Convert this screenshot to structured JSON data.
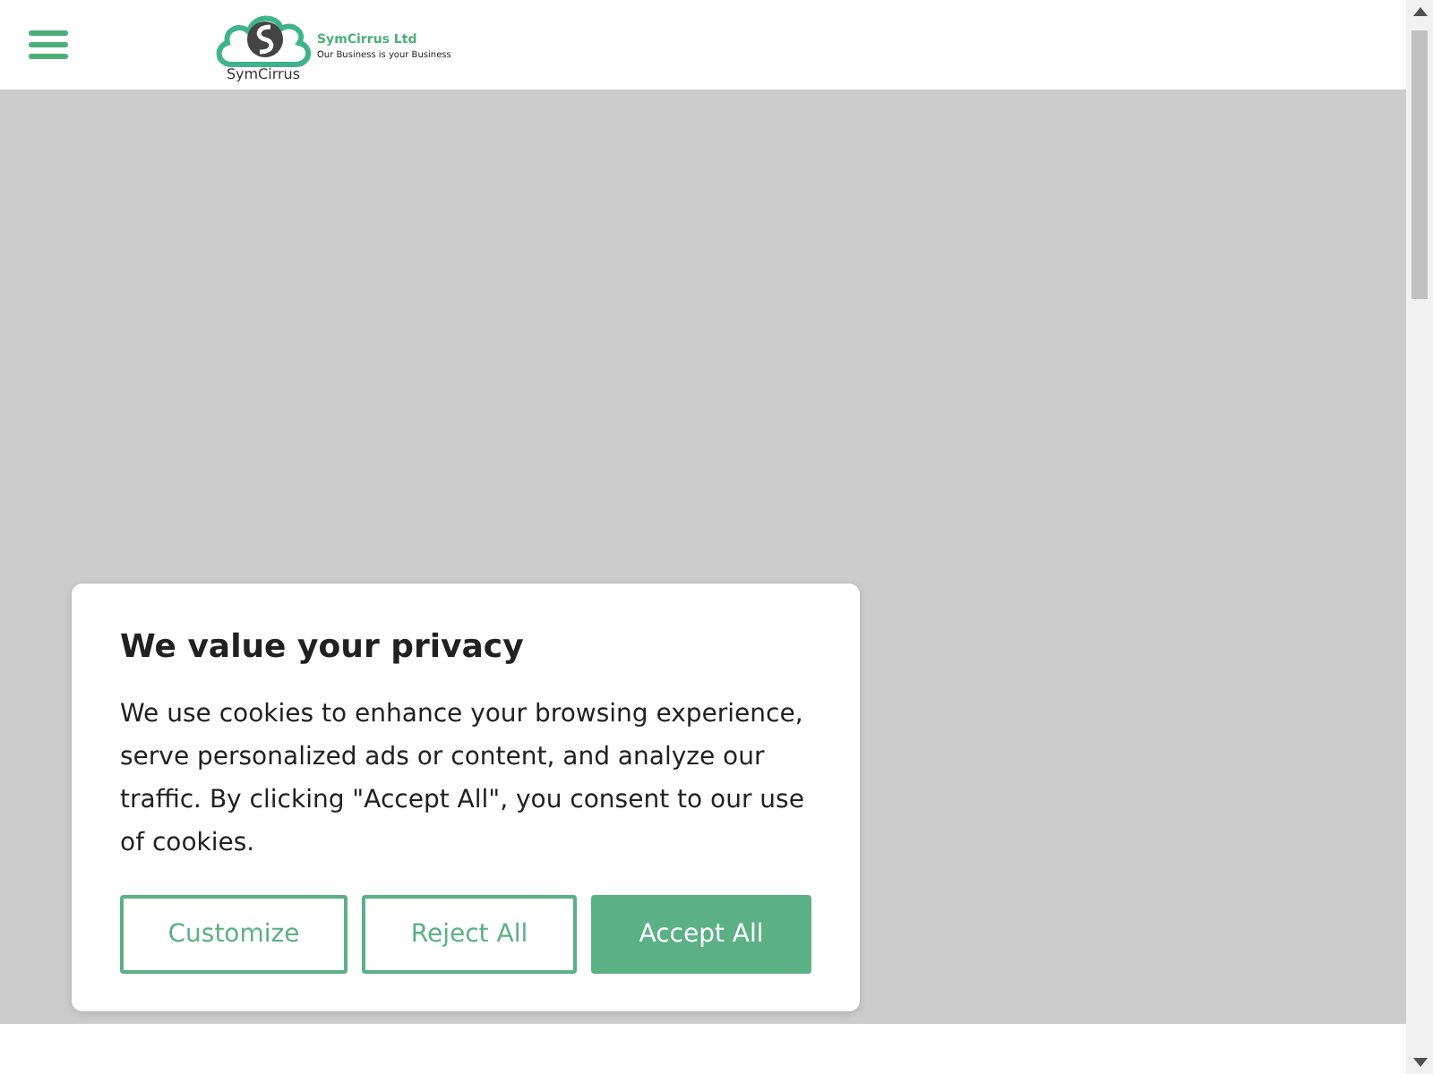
{
  "header": {
    "brand_name": "SymCirrus Ltd",
    "tagline": "Our Business is your Business",
    "logo_caption": "SymCirrus"
  },
  "cookie_banner": {
    "title": "We value your privacy",
    "message": "We use cookies to enhance your browsing experience, serve personalized ads or content, and analyze our traffic. By clicking \"Accept All\", you consent to our use of cookies.",
    "buttons": [
      {
        "label": "Customize",
        "kind": "outline"
      },
      {
        "label": "Reject All",
        "kind": "outline"
      },
      {
        "label": "Accept All",
        "kind": "filled"
      }
    ]
  }
}
